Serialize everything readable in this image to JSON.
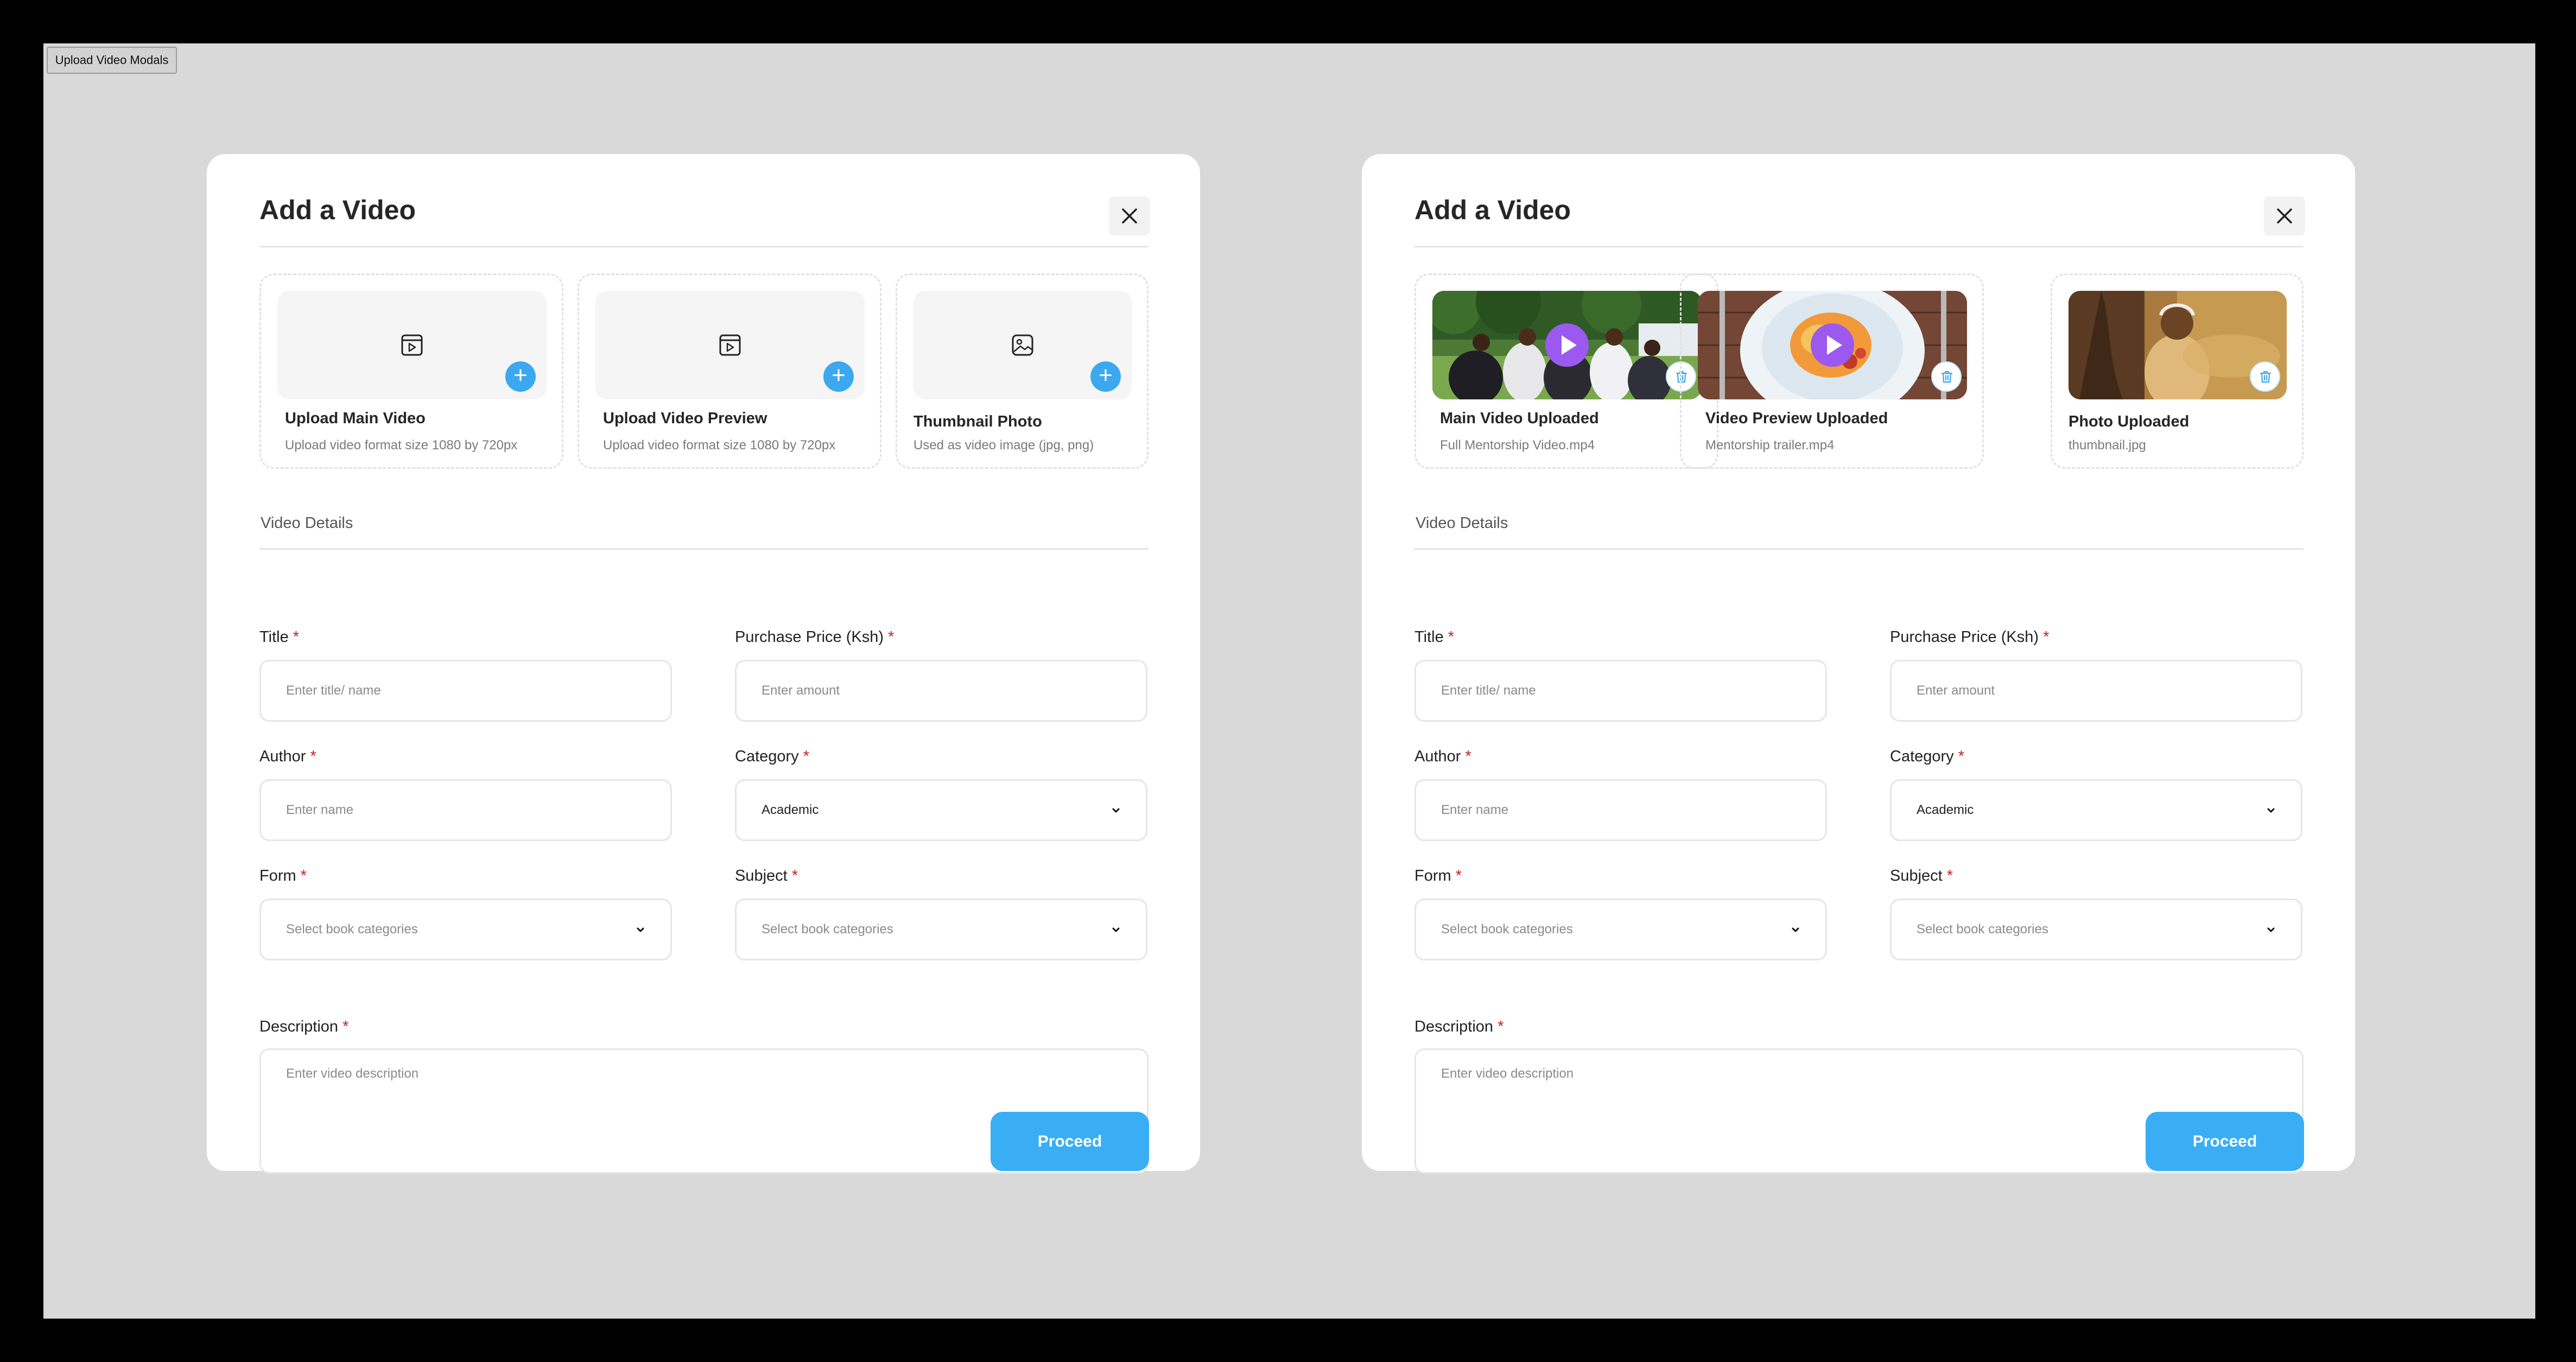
{
  "frame_label": "Upload Video Modals",
  "colors": {
    "accent": "#39aef5",
    "play": "#9b59f0",
    "required": "#c81f1f",
    "backdrop": "#d9d9d9"
  },
  "modals": [
    {
      "title": "Add a Video",
      "upload_cards": [
        {
          "title": "Upload Main Video",
          "subtitle": "Upload video format size 1080 by 720px",
          "icon": "video-file-icon",
          "action": "plus-icon"
        },
        {
          "title": "Upload Video Preview",
          "subtitle": "Upload video format size 1080 by 720px",
          "icon": "video-file-icon",
          "action": "plus-icon"
        },
        {
          "title": "Thumbnail Photo",
          "subtitle": "Used as video image (jpg, png)",
          "icon": "image-icon",
          "action": "plus-icon"
        }
      ],
      "section_label": "Video Details",
      "fields": {
        "title": {
          "label": "Title",
          "required": "*",
          "placeholder": "Enter title/ name"
        },
        "price": {
          "label": "Purchase Price (Ksh)",
          "required": "*",
          "placeholder": "Enter amount"
        },
        "author": {
          "label": "Author",
          "required": "*",
          "placeholder": "Enter name"
        },
        "category": {
          "label": "Category",
          "required": "*",
          "value": "Academic"
        },
        "form": {
          "label": "Form",
          "required": "*",
          "placeholder": "Select book categories"
        },
        "subject": {
          "label": "Subject",
          "required": "*",
          "placeholder": "Select book categories"
        },
        "description": {
          "label": "Description",
          "required": "*",
          "placeholder": "Enter video description"
        }
      },
      "proceed_label": "Proceed"
    },
    {
      "title": "Add a Video",
      "upload_cards": [
        {
          "title": "Main Video Uploaded",
          "subtitle": "Full Mentorship Video.mp4",
          "icon": "play-icon",
          "action": "trash-icon"
        },
        {
          "title": "Video Preview Uploaded",
          "subtitle": "Mentorship trailer.mp4",
          "icon": "play-icon",
          "action": "trash-icon"
        },
        {
          "title": "Photo Uploaded",
          "subtitle": "thumbnail.jpg",
          "icon": "",
          "action": "trash-icon"
        }
      ],
      "section_label": "Video Details",
      "fields": {
        "title": {
          "label": "Title",
          "required": "*",
          "placeholder": "Enter title/ name"
        },
        "price": {
          "label": "Purchase Price (Ksh)",
          "required": "*",
          "placeholder": "Enter amount"
        },
        "author": {
          "label": "Author",
          "required": "*",
          "placeholder": "Enter name"
        },
        "category": {
          "label": "Category",
          "required": "*",
          "value": "Academic"
        },
        "form": {
          "label": "Form",
          "required": "*",
          "placeholder": "Select book categories"
        },
        "subject": {
          "label": "Subject",
          "required": "*",
          "placeholder": "Select book categories"
        },
        "description": {
          "label": "Description",
          "required": "*",
          "placeholder": "Enter video description"
        }
      },
      "proceed_label": "Proceed"
    }
  ]
}
